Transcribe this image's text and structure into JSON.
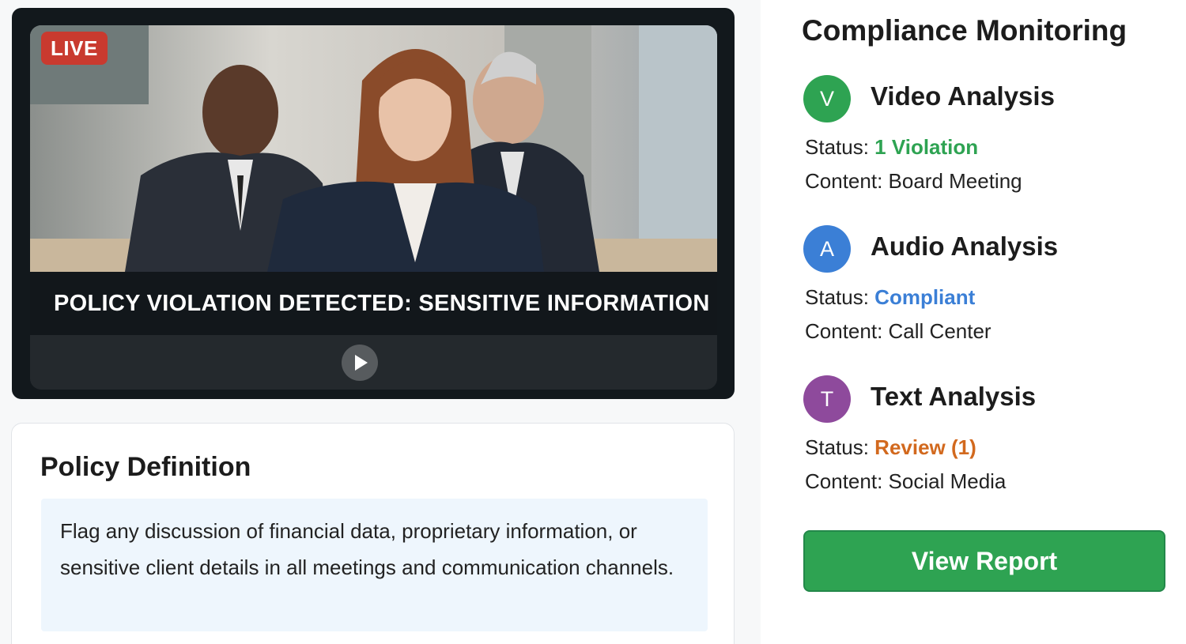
{
  "video": {
    "live_label": "LIVE",
    "alert_text": "POLICY VIOLATION DETECTED: SENSITIVE INFORMATION",
    "play_icon": "play-icon"
  },
  "policy": {
    "title": "Policy Definition",
    "text": "Flag any discussion of financial data, proprietary information, or sensitive client details in all meetings and communication channels."
  },
  "monitoring": {
    "title": "Compliance Monitoring",
    "status_label": "Status:",
    "content_label": "Content:",
    "analyses": [
      {
        "initial": "V",
        "title": "Video Analysis",
        "status": "1 Violation",
        "content": "Board Meeting",
        "avatar_color": "#2ea352",
        "status_color": "#2ea352"
      },
      {
        "initial": "A",
        "title": "Audio Analysis",
        "status": "Compliant",
        "content": "Call Center",
        "avatar_color": "#3b7fd6",
        "status_color": "#3b7fd6"
      },
      {
        "initial": "T",
        "title": "Text Analysis",
        "status": "Review (1)",
        "content": "Social Media",
        "avatar_color": "#8e4a9c",
        "status_color": "#d2691e"
      }
    ],
    "button_label": "View Report"
  }
}
